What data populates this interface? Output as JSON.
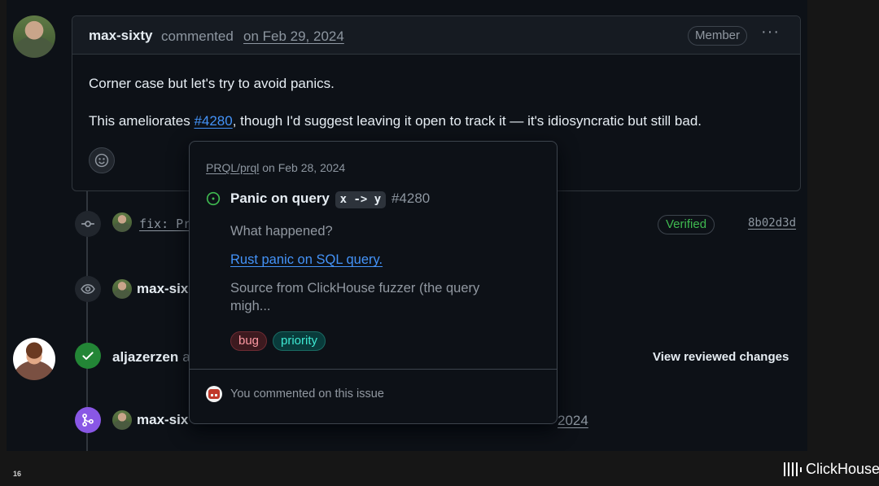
{
  "comment": {
    "author": "max-sixty",
    "verb": "commented",
    "date": "on Feb 29, 2024",
    "role_badge": "Member",
    "more_actions_glyph": "···",
    "body_line1": "Corner case but let's try to avoid panics.",
    "body_line2_before": "This ameliorates ",
    "body_line2_link": "#4280",
    "body_line2_after": ", though I'd suggest leaving it open to track it — it's idiosyncratic but still bad.",
    "reaction_icon": "smiley-icon"
  },
  "timeline": {
    "commit_event": {
      "icon": "git-commit-icon",
      "message_visible": "fix: Pr",
      "verified_label": "Verified",
      "sha": "8b02d3d"
    },
    "view_event": {
      "icon": "eye-icon",
      "actor_visible": "max-six"
    },
    "review_event": {
      "icon": "check-icon",
      "actor": "aljazerzen",
      "actor_suffix_visible": "a",
      "action_label": "View reviewed changes"
    },
    "merge_event": {
      "icon": "git-merge-icon",
      "actor_visible": "max-six",
      "date_visible": "2024"
    }
  },
  "hovercard": {
    "repo": "PRQL/prql",
    "repo_date": " on Feb 28, 2024",
    "status_icon": "issue-open-icon",
    "title_text": "Panic on query",
    "title_code_1": "x",
    "title_code_arrow": "->",
    "title_code_2": "y",
    "issue_number": "#4280",
    "body_line1": "What happened?",
    "body_link": "Rust panic on SQL query.",
    "body_line3": "Source from ClickHouse fuzzer (the query",
    "body_line4": "migh...",
    "labels": [
      "bug",
      "priority"
    ],
    "footer_text": "You commented on this issue"
  },
  "slide": {
    "page_number": "16",
    "brand": "ClickHouse"
  },
  "colors": {
    "background": "#0d1117",
    "link": "#4493f8",
    "verified": "#3fb950",
    "merged": "#8957e5",
    "approved": "#238636"
  }
}
